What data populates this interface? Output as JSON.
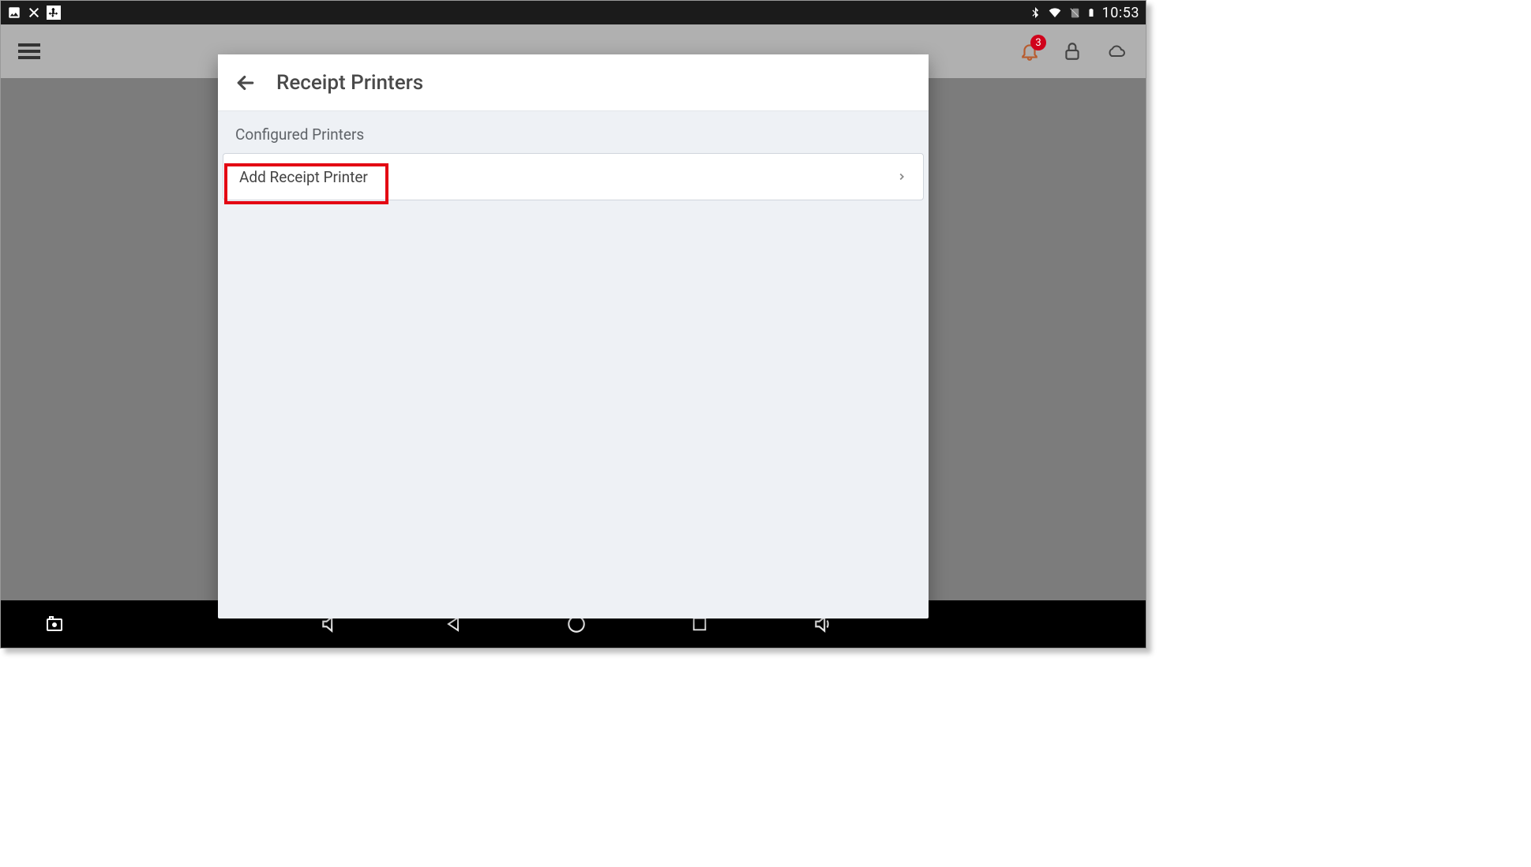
{
  "statusbar": {
    "clock": "10:53",
    "notification_badge": "3"
  },
  "dialog": {
    "title": "Receipt Printers",
    "section_label": "Configured Printers",
    "row": {
      "label": "Add Receipt Printer"
    }
  }
}
